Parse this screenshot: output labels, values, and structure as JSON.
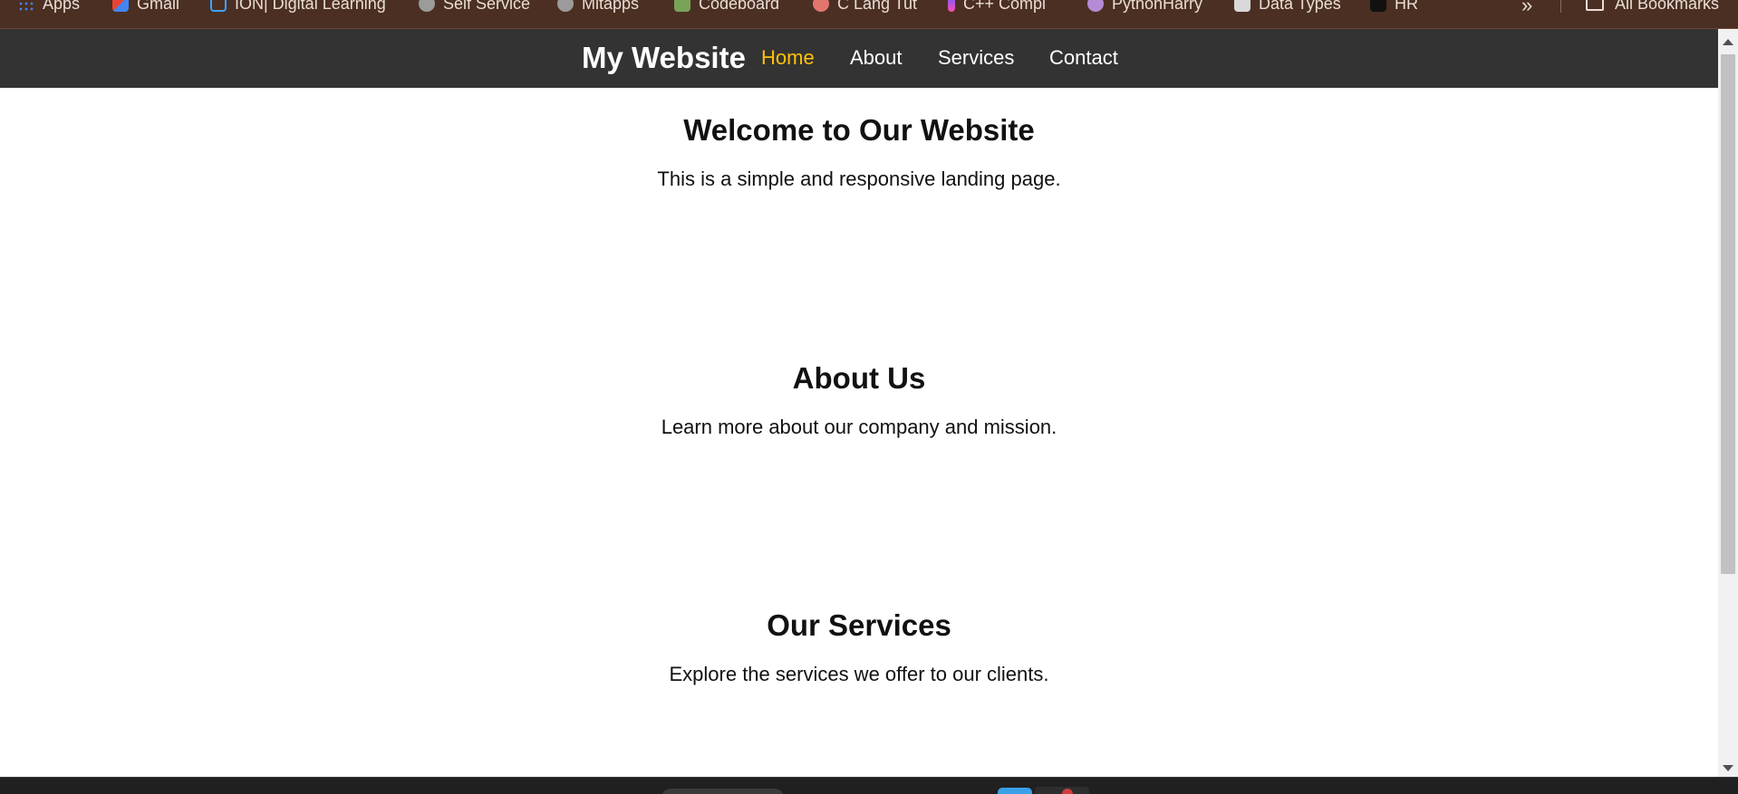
{
  "bookmarks": [
    {
      "label": "Apps",
      "icon": "apps-grid-icon"
    },
    {
      "label": "Gmail",
      "icon": "gmail-icon"
    },
    {
      "label": "ION| Digital Learning",
      "icon": "ion-icon"
    },
    {
      "label": "Self Service",
      "icon": "globe-icon"
    },
    {
      "label": "Mitapps",
      "icon": "globe-icon"
    },
    {
      "label": "Codeboard",
      "icon": "codeboard-icon"
    },
    {
      "label": "C Lang Tut",
      "icon": "c-lang-icon"
    },
    {
      "label": "C++ Compi",
      "icon": "cpp-icon"
    },
    {
      "label": "PythonHarry",
      "icon": "python-icon"
    },
    {
      "label": "Data Types",
      "icon": "data-types-icon"
    },
    {
      "label": "HR",
      "icon": "hackerrank-icon"
    }
  ],
  "bookmarks_more": "»",
  "all_bookmarks": "All Bookmarks",
  "site": {
    "title": "My Website"
  },
  "nav": [
    {
      "label": "Home",
      "active": true
    },
    {
      "label": "About",
      "active": false
    },
    {
      "label": "Services",
      "active": false
    },
    {
      "label": "Contact",
      "active": false
    }
  ],
  "sections": [
    {
      "heading": "Welcome to Our Website",
      "text": "This is a simple and responsive landing page."
    },
    {
      "heading": "About Us",
      "text": "Learn more about our company and mission."
    },
    {
      "heading": "Our Services",
      "text": "Explore the services we offer to our clients."
    }
  ],
  "colors": {
    "navbar_bg": "#333333",
    "active_link": "#ffc107",
    "bookmarks_bg": "#4b2f22"
  }
}
